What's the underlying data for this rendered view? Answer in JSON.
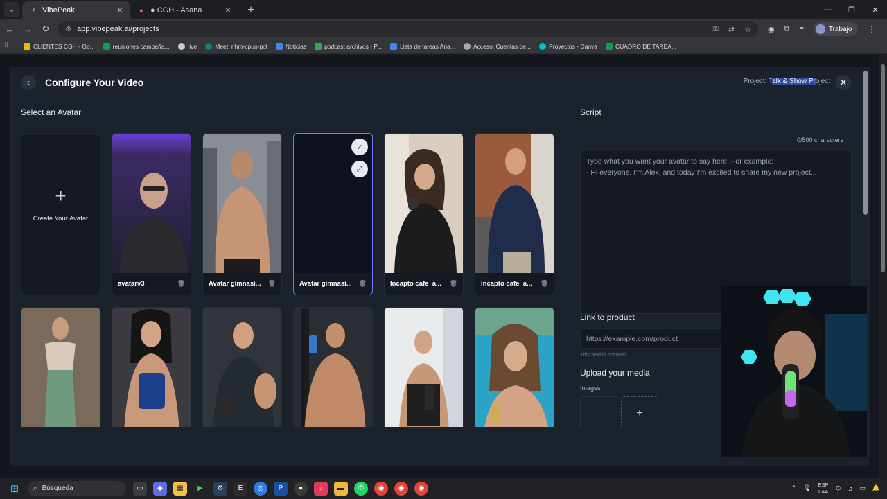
{
  "browser": {
    "tabs": [
      {
        "label": "VibePeak",
        "active": true
      },
      {
        "label": "● CGH - Asana",
        "active": false
      }
    ],
    "url": "app.vibepeak.ai/projects",
    "profile": "Trabajo",
    "bookmarks": [
      {
        "label": "CLIENTES CGH - Go...",
        "color": "#f4b400"
      },
      {
        "label": "reuniones campaña...",
        "color": "#0f9d58"
      },
      {
        "label": "rive",
        "color": "#cccccc"
      },
      {
        "label": "Meet: nhm-cpuo-pct",
        "color": "#00897b"
      },
      {
        "label": "Noticias",
        "color": "#4285f4"
      },
      {
        "label": "podcast archivos - P...",
        "color": "#34a853"
      },
      {
        "label": "Lista de tareas Ana...",
        "color": "#4285f4"
      },
      {
        "label": "Acceso: Cuentas de...",
        "color": "#aaaaaa"
      },
      {
        "label": "Proyectos - Canva",
        "color": "#00c4cc"
      },
      {
        "label": "CUADRO DE TAREA...",
        "color": "#0f9d58"
      }
    ]
  },
  "modal": {
    "title": "Configure Your Video",
    "project_prefix": "Project: ",
    "project_plain_1": "T",
    "project_highlight": "alk & Show Pr",
    "project_plain_2": "oject",
    "select_avatar_title": "Select an Avatar",
    "create_avatar_label": "Create Your Avatar",
    "avatars_row1": [
      {
        "name": "avatarv3"
      },
      {
        "name": "Avatar gimnasi..."
      },
      {
        "name": "Avatar gimnasi...",
        "selected": true
      },
      {
        "name": "Incapto cafe_a..."
      },
      {
        "name": "Incapto cafe_a..."
      }
    ],
    "script": {
      "title": "Script",
      "char_count": "0/500 characters",
      "placeholder_line1": "Type what you want your avatar to say here. For example:",
      "placeholder_line2": "- Hi everyone, I'm Alex, and today I'm excited to share my new project..."
    },
    "link": {
      "title": "Link to product",
      "placeholder": "https://example.com/product",
      "hint": "This field is optional"
    },
    "media": {
      "title": "Upload your media",
      "images_label": "Images"
    }
  },
  "taskbar": {
    "search_label": "Búsqueda",
    "lang_line1": "ESP",
    "lang_line2": "LAA"
  }
}
